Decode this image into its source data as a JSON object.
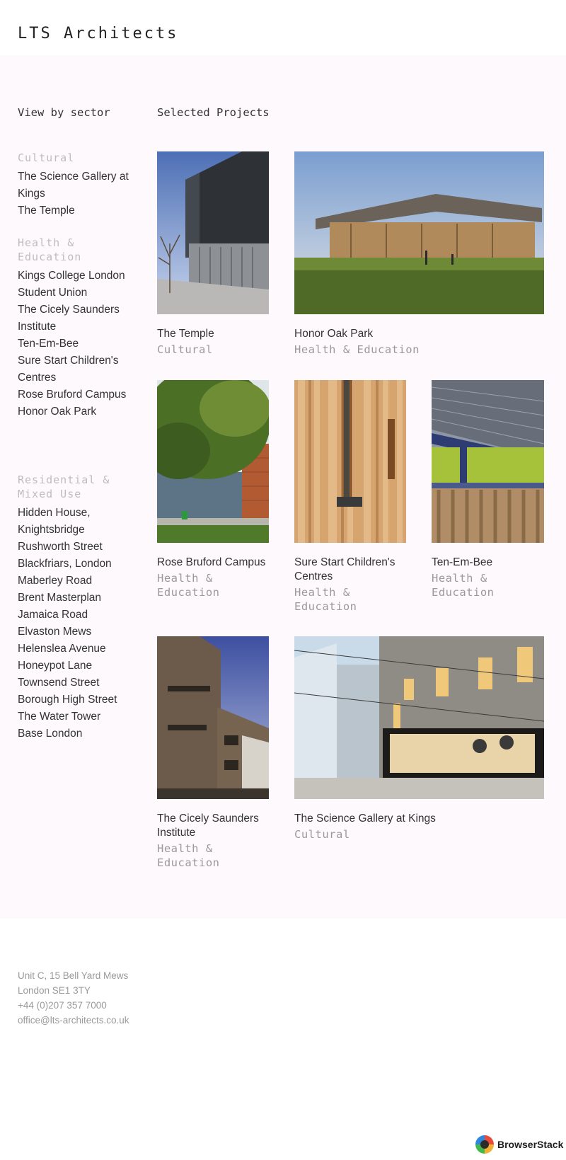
{
  "header": {
    "logo": "LTS Architects"
  },
  "sidebar": {
    "title": "View by sector",
    "sectors": [
      {
        "name": "Cultural",
        "links": [
          "The Science Gallery at Kings",
          "The Temple"
        ]
      },
      {
        "name": "Health & Education",
        "links": [
          "Kings College London Student Union",
          "The Cicely Saunders Institute",
          "Ten-Em-Bee",
          "Sure Start Children's Centres",
          "Rose Bruford Campus",
          "Honor Oak Park"
        ]
      },
      {
        "name": "Residential & Mixed Use",
        "links": [
          "Hidden House, Knightsbridge",
          "Rushworth Street",
          "Blackfriars, London",
          "Maberley Road",
          "Brent Masterplan",
          "Jamaica Road",
          "Elvaston Mews",
          "Helenslea Avenue",
          "Honeypot Lane",
          "Townsend Street",
          "Borough High Street",
          "The Water Tower",
          "Base London"
        ]
      }
    ]
  },
  "main": {
    "title": "Selected Projects",
    "projects": [
      {
        "title": "The Temple",
        "sector": "Cultural",
        "image": "dark-facade-building-photo"
      },
      {
        "title": "Honor Oak Park",
        "sector": "Health & Education",
        "image": "pavilion-on-field-photo"
      },
      {
        "title": "Rose Bruford Campus",
        "sector": "Health & Education",
        "image": "brick-campus-tree-photo"
      },
      {
        "title": "Sure Start Children's Centres",
        "sector": "Health & Education",
        "image": "timber-cladding-photo"
      },
      {
        "title": "Ten-Em-Bee",
        "sector": "Health & Education",
        "image": "canopy-balcony-photo"
      },
      {
        "title": "The Cicely Saunders Institute",
        "sector": "Health & Education",
        "image": "brick-institute-photo"
      },
      {
        "title": "The Science Gallery at Kings",
        "sector": "Cultural",
        "image": "gallery-street-render"
      }
    ]
  },
  "footer": {
    "address_line1": "Unit C, 15 Bell Yard Mews",
    "address_line2": "London SE1 3TY",
    "phone": "+44 (0)207 357 7000",
    "email": "office@lts-architects.co.uk"
  },
  "badge": {
    "label": "BrowserStack",
    "icon": "browserstack-icon"
  }
}
